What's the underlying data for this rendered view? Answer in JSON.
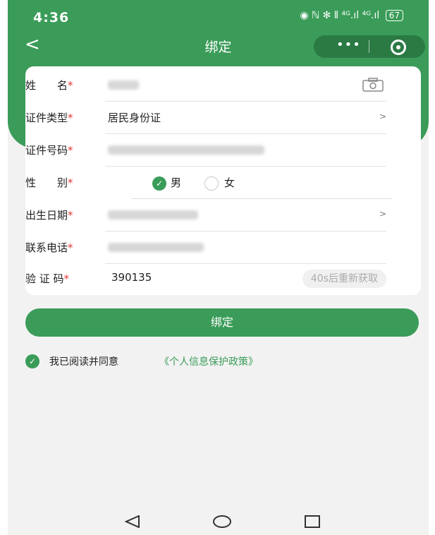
{
  "status": {
    "time": "4:36",
    "icons": "◉ ℕ ✻ ⦀ ⁴ᴳ.ıl ⁴ᴳ.ıl",
    "battery": "67"
  },
  "nav": {
    "back": "<",
    "title": "绑定",
    "more": "•••"
  },
  "form": {
    "name_label": "姓　　名",
    "idtype_label": "证件类型",
    "idtype_value": "居民身份证",
    "idnum_label": "证件号码",
    "gender_label": "性　　别",
    "gender_male": "男",
    "gender_female": "女",
    "birth_label": "出生日期",
    "phone_label": "联系电话",
    "code_label": "验 证 码",
    "code_value": "390135",
    "code_button": "40s后重新获取",
    "star": "*",
    "chevron": ">"
  },
  "bind_button": "绑定",
  "agree": {
    "text": "我已阅读并同意",
    "policy": "《个人信息保护政策》"
  },
  "colors": {
    "primary": "#3a9c58",
    "required": "#e53935"
  }
}
